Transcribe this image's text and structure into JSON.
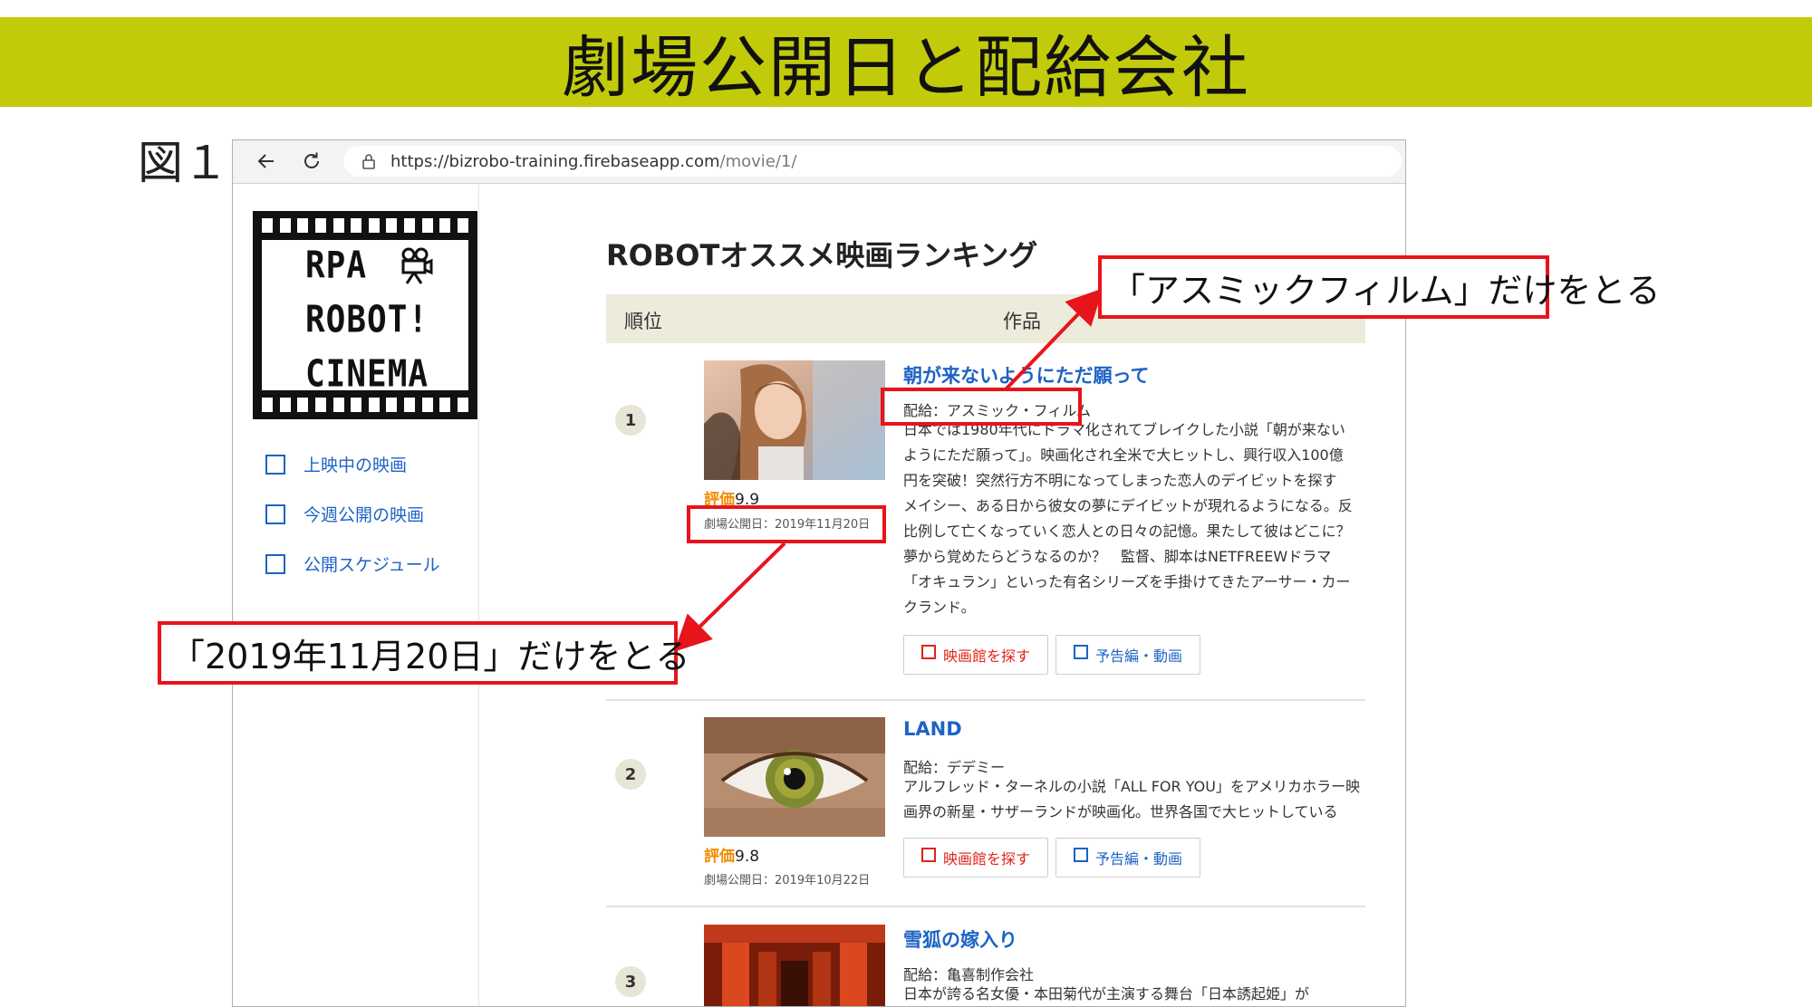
{
  "slide": {
    "title": "劇場公開日と配給会社",
    "figure_label": "図１"
  },
  "browser": {
    "url_host": "https://bizrobo-training.firebaseapp.com",
    "url_path": "/movie/1/"
  },
  "sidebar": {
    "logo_lines": [
      "RPA",
      "ROBOT!",
      "CINEMA"
    ],
    "items": [
      {
        "label": "上映中の映画"
      },
      {
        "label": "今週公開の映画"
      },
      {
        "label": "公開スケジュール"
      }
    ]
  },
  "main": {
    "heading": "ROBOTオススメ映画ランキング",
    "columns": [
      "順位",
      "作品"
    ],
    "rating_label": "評価",
    "buttons": {
      "theater": "映画館を探す",
      "trailer": "予告編・動画"
    },
    "movies": [
      {
        "rank": "1",
        "title": "朝が来ないようにただ願って",
        "distributor": "配給：アスミック・フィルム",
        "rating": "9.9",
        "release": "劇場公開日：2019年11月20日",
        "description_lines": [
          "日本では1980年代にドラマ化されてブレイクした小説「朝が来ない",
          "ようにただ願って」。映画化され全米で大ヒットし、興行収入100億",
          "円を突破！突然行方不明になってしまった恋人のデイビットを探す",
          "メイシー、ある日から彼女の夢にデイビットが現れるようになる。反",
          "比例して亡くなっていく恋人との日々の記憶。果たして彼はどこに？",
          "夢から覚めたらどうなるのか？　監督、脚本はNETFREEWドラマ",
          "「オキュラン」といった有名シリーズを手掛けてきたアーサー・カー",
          "クランド。"
        ]
      },
      {
        "rank": "2",
        "title": "LAND",
        "distributor": "配給：デデミー",
        "rating": "9.8",
        "release": "劇場公開日：2019年10月22日",
        "description_lines": [
          "アルフレッド・ターネルの小説「ALL FOR YOU」をアメリカホラー映",
          "画界の新星・サザーランドが映画化。世界各国で大ヒットしている"
        ]
      },
      {
        "rank": "3",
        "title": "雪狐の嫁入り",
        "distributor": "配給：亀喜制作会社",
        "description_lines": [
          "日本が誇る名女優・本田菊代が主演する舞台「日本誘起姫」が"
        ]
      }
    ]
  },
  "annotations": {
    "distributor_callout": "「アスミックフィルム」だけをとる",
    "release_callout": "「2019年11月20日」だけをとる"
  }
}
